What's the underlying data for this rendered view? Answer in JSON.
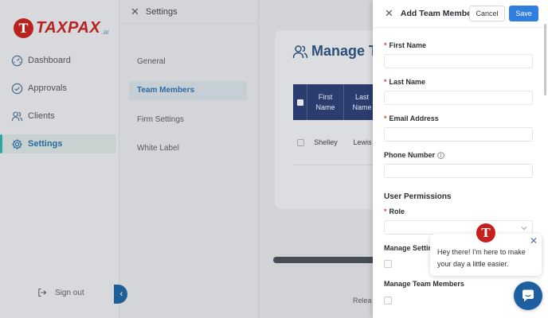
{
  "logo": {
    "badge": "T",
    "text": "TAXPAX",
    "suffix": ".ai"
  },
  "sidebar": {
    "items": [
      {
        "label": "Dashboard",
        "icon": "dashboard-icon"
      },
      {
        "label": "Approvals",
        "icon": "check-circle-icon"
      },
      {
        "label": "Clients",
        "icon": "users-icon"
      },
      {
        "label": "Settings",
        "icon": "gear-icon",
        "active": true
      }
    ],
    "signout": "Sign out",
    "collapse_icon": "‹"
  },
  "settings": {
    "title": "Settings",
    "close_icon": "✕",
    "items": [
      {
        "label": "General"
      },
      {
        "label": "Team Members",
        "active": true
      },
      {
        "label": "Firm Settings"
      },
      {
        "label": "White Label"
      }
    ]
  },
  "main": {
    "title": "Manage T",
    "table": {
      "headers": [
        "First Name",
        "Last Name"
      ],
      "rows": [
        [
          "Shelley",
          "Lewis"
        ]
      ]
    },
    "release": "Relea"
  },
  "drawer": {
    "title": "Add Team Member",
    "close_icon": "✕",
    "cancel_label": "Cancel",
    "save_label": "Save",
    "required_mark": "*",
    "fields": {
      "first_name": "First Name",
      "last_name": "Last Name",
      "email": "Email Address",
      "phone": "Phone Number"
    },
    "permissions_title": "User Permissions",
    "role_label": "Role",
    "manage_settings": "Manage Settin",
    "manage_team": "Manage Team Members"
  },
  "chat": {
    "avatar": "T",
    "close_icon": "✕",
    "message": "Hey there! I'm here to make your day a little easier."
  },
  "colors": {
    "brand_red": "#b8231f",
    "primary_blue": "#2e7fe0",
    "table_header": "#2a3d6e",
    "active_accent": "#2fa6a0"
  }
}
